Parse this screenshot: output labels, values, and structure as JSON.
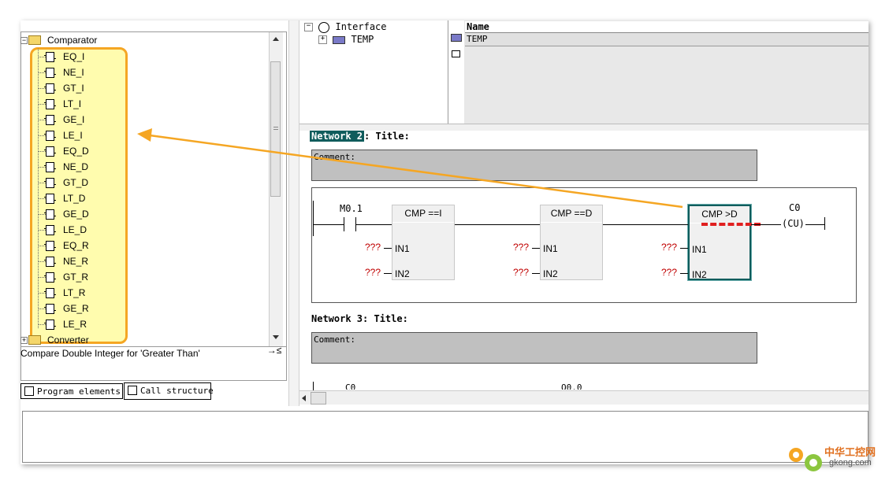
{
  "tree": {
    "root_label": "Comparator",
    "items": [
      "EQ_I",
      "NE_I",
      "GT_I",
      "LT_I",
      "GE_I",
      "LE_I",
      "EQ_D",
      "NE_D",
      "GT_D",
      "LT_D",
      "GE_D",
      "LE_D",
      "EQ_R",
      "NE_R",
      "GT_R",
      "LT_R",
      "GE_R",
      "LE_R"
    ],
    "next_folder": "Converter"
  },
  "info_text": "Compare Double Integer for 'Greater Than'",
  "info_button": "→≤",
  "tabs": [
    "Program elements",
    "Call structure"
  ],
  "interface": {
    "root": "Interface",
    "child": "TEMP"
  },
  "name_table": {
    "header": "Name",
    "row": "TEMP"
  },
  "network2": {
    "label": "Network 2",
    "title": ": Title:",
    "comment": "Comment:",
    "contact": "M0.1",
    "boxes": [
      {
        "title": "CMP ==I",
        "in1": "IN1",
        "in2": "IN2",
        "val1": "???",
        "val2": "???"
      },
      {
        "title": "CMP ==D",
        "in1": "IN1",
        "in2": "IN2",
        "val1": "???",
        "val2": "???"
      },
      {
        "title": "CMP >D",
        "in1": "IN1",
        "in2": "IN2",
        "val1": "???",
        "val2": "???"
      }
    ],
    "coil_name": "C0",
    "coil_text": "(CU)"
  },
  "network3": {
    "label": "Network 3",
    "title": ": Title:",
    "comment": "Comment:",
    "partial_left": "C0",
    "partial_right": "Q0.0"
  },
  "watermark": {
    "title": "中华工控网",
    "url": "gkong.com"
  },
  "colors": {
    "highlight_fill": "#fffa78",
    "highlight_border": "#f5a623",
    "arrow": "#f5a623",
    "selection": "#0f5c5c",
    "placeholder": "#c00000",
    "red_dash": "#e02020"
  }
}
